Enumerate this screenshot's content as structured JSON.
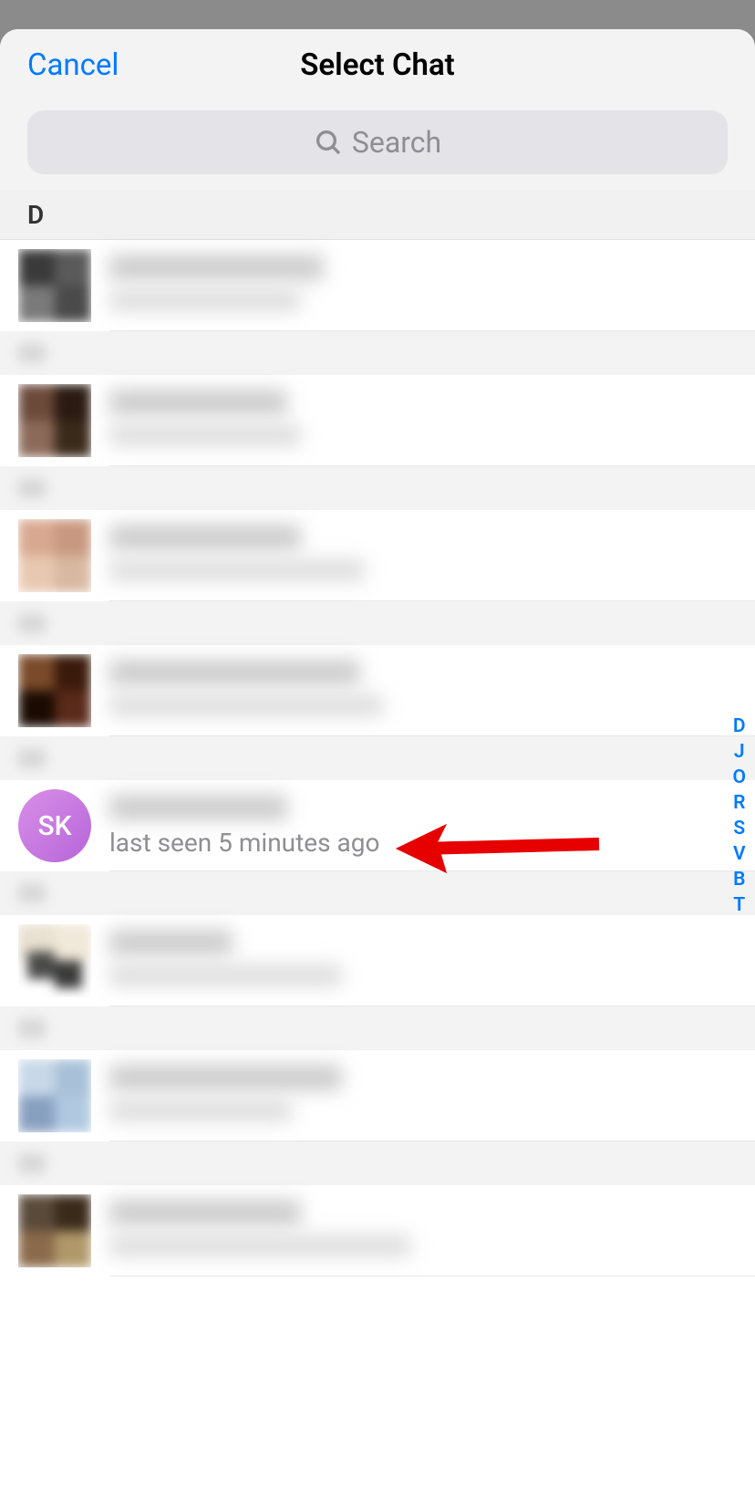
{
  "header": {
    "cancel": "Cancel",
    "title": "Select Chat"
  },
  "search": {
    "placeholder": "Search"
  },
  "section_letter": "D",
  "contacts": [
    {
      "avatar_type": "blur1",
      "name_blur_width": 235,
      "status_blur_width": 210
    },
    {
      "avatar_type": "blur2",
      "name_blur_width": 195,
      "status_blur_width": 210
    },
    {
      "avatar_type": "blur3",
      "name_blur_width": 210,
      "status_blur_width": 280
    },
    {
      "avatar_type": "blur4",
      "name_blur_width": 275,
      "status_blur_width": 300
    },
    {
      "avatar_type": "sk",
      "avatar_text": "SK",
      "name_blur_width": 195,
      "status_text": "last seen 5 minutes ago"
    },
    {
      "avatar_type": "blur5",
      "name_blur_width": 135,
      "status_blur_width": 255
    },
    {
      "avatar_type": "blur6",
      "name_blur_width": 255,
      "status_blur_width": 200
    },
    {
      "avatar_type": "blur7",
      "name_blur_width": 210,
      "status_blur_width": 330
    }
  ],
  "index_letters": [
    "D",
    "J",
    "O",
    "R",
    "S",
    "V",
    "B",
    "T"
  ]
}
